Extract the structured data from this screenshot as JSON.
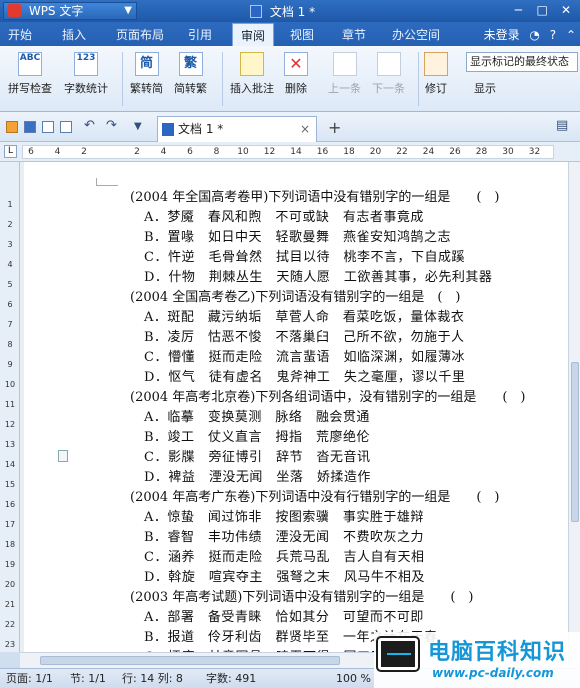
{
  "titlebar": {
    "app_name": "WPS 文字",
    "doc_title": "文档 1 *"
  },
  "menu": {
    "tabs": [
      "开始",
      "插入",
      "页面布局",
      "引用",
      "审阅",
      "视图",
      "章节",
      "办公空间"
    ],
    "active": "审阅",
    "login": "未登录"
  },
  "ribbon": {
    "spellcheck": "拼写检查",
    "wordcount": "字数统计",
    "trad_to_simp": "繁转简",
    "simp_to_trad": "简转繁",
    "insert_comment": "插入批注",
    "delete": "删除",
    "prev": "上一条",
    "next": "下一条",
    "revise": "修订",
    "show": "显示",
    "markup_combo": "显示标记的最终状态",
    "icon_abc": "ABC",
    "icon_123": "123",
    "icon_jian": "简",
    "icon_fan": "繁"
  },
  "doc_tab": {
    "label": "文档 1 *",
    "close": "×",
    "add": "+"
  },
  "ruler": {
    "corner": "L",
    "ticks": [
      "6",
      "4",
      "2",
      "",
      "2",
      "4",
      "6",
      "8",
      "10",
      "12",
      "14",
      "16",
      "18",
      "20",
      "22",
      "24",
      "26",
      "28",
      "30",
      "32"
    ],
    "vticks": [
      "1",
      "2",
      "3",
      "4",
      "5",
      "6",
      "7",
      "8",
      "9",
      "10",
      "11",
      "12",
      "13",
      "14",
      "15",
      "16",
      "17",
      "18",
      "19",
      "20",
      "21",
      "22",
      "23"
    ]
  },
  "document": {
    "questions": [
      {
        "stem": "(2004 年全国高考卷甲)下列词语中没有错别字的一组是　　(　)",
        "options": [
          "A．梦魇　春风和煦　不可或缺　有志者事竟成",
          "B．置喙　如日中天　轻歌曼舞　燕雀安知鸿鹄之志",
          "C．忤逆　毛骨耸然　拭目以待　桃李不言，下自成蹊",
          "D．什物　荆棘丛生　天随人愿　工欲善其事，必先利其器"
        ]
      },
      {
        "stem": "(2004 全国高考卷乙)下列词语没有错别字的一组是　(　)",
        "options": [
          "A．斑配　藏污纳垢　草菅人命　看菜吃饭，量体裁衣",
          "B．凌厉　怙恶不悛　不落巢臼　己所不欲，勿施于人",
          "C．懵懂　挺而走险　流言蜚语　如临深渊，如履薄冰",
          "D．怄气　徒有虚名　鬼斧神工　失之毫厘，谬以千里"
        ]
      },
      {
        "stem": "(2004 年高考北京卷)下列各组词语中，没有错别字的一组是　　(　)",
        "options": [
          "A．临摹　变换莫测　脉络　融会贯通",
          "B．竣工　仗义直言　拇指　荒廖绝伦",
          "C．影牒　旁征博引　辞节　沓无音讯",
          "D．裨益　湮没无闻　坐落　娇揉造作"
        ]
      },
      {
        "stem": "(2004 年高考广东卷)下列词语中没有行错别字的一组是　　(　)",
        "options": [
          "A．惊蛰　闻过饰非　按图索骥　事实胜于雄辩",
          "B．睿智　丰功伟绩　湮没无闻　不费吹灰之力",
          "C．涵养　挺而走险　兵荒马乱　吉人自有天相",
          "D．斡旋　喧宾夺主　强弩之末　风马牛不相及"
        ]
      },
      {
        "stem": "(2003 年高考试题)下列词语中没有错别字的一组是　　(　)",
        "options": [
          "A．部署　备受青睐　恰如其分　可望而不可即",
          "B．报道　伶牙利齿　群贤毕至　一年之计在于春",
          "C．擂座　甘意图悬　暗无可得　同工五好"
        ]
      }
    ]
  },
  "status": {
    "page": "页面: 1/1",
    "section": "节: 1/1",
    "row_col": "行: 14  列: 8",
    "chars": "字数: 491",
    "zoom": "100 %"
  },
  "watermark": {
    "name": "电脑百科知识",
    "url": "www.pc-daily.com"
  }
}
